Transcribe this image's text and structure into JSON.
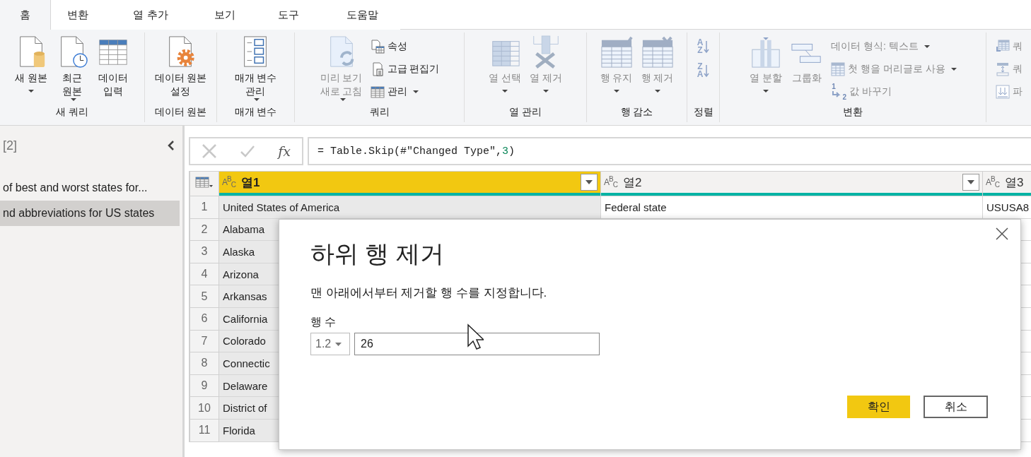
{
  "tabs": [
    {
      "label": "홈",
      "selected": true
    },
    {
      "label": "변환",
      "selected": false
    },
    {
      "label": "열 추가",
      "selected": false
    },
    {
      "label": "보기",
      "selected": false
    },
    {
      "label": "도구",
      "selected": false
    },
    {
      "label": "도움말",
      "selected": false
    }
  ],
  "ribbon": {
    "groups": [
      {
        "label": "새 쿼리",
        "items": [
          {
            "kind": "large",
            "label": "새 원본",
            "dropdown": true,
            "disabled": false
          },
          {
            "kind": "large",
            "label": "최근\n원본",
            "dropdown": true,
            "disabled": false
          },
          {
            "kind": "large",
            "label": "데이터\n입력",
            "disabled": false
          }
        ]
      },
      {
        "label": "데이터 원본",
        "items": [
          {
            "kind": "large",
            "label": "데이터 원본\n설정",
            "disabled": false
          }
        ]
      },
      {
        "label": "매개 변수",
        "items": [
          {
            "kind": "large",
            "label": "매개 변수\n관리",
            "dropdown": true,
            "disabled": false
          }
        ]
      },
      {
        "label": "쿼리",
        "items": [
          {
            "kind": "large",
            "label": "미리 보기\n새로 고침",
            "dropdown": true,
            "disabled": true
          },
          {
            "kind": "stack",
            "items": [
              {
                "label": "속성",
                "disabled": false
              },
              {
                "label": "고급 편집기",
                "disabled": false
              },
              {
                "label": "관리",
                "dropdown": true,
                "disabled": false
              }
            ]
          }
        ]
      },
      {
        "label": "열 관리",
        "items": [
          {
            "kind": "large",
            "label": "열 선택",
            "dropdown": true,
            "disabled": true
          },
          {
            "kind": "large",
            "label": "열 제거",
            "dropdown": true,
            "disabled": true
          }
        ]
      },
      {
        "label": "행 감소",
        "items": [
          {
            "kind": "large",
            "label": "행 유지",
            "dropdown": true,
            "disabled": true
          },
          {
            "kind": "large",
            "label": "행 제거",
            "dropdown": true,
            "disabled": true
          }
        ]
      },
      {
        "label": "정렬",
        "items": [
          {
            "kind": "sort",
            "top": "A",
            "bottom": "Z",
            "disabled": true
          },
          {
            "kind": "sort",
            "top": "Z",
            "bottom": "A",
            "disabled": true
          }
        ]
      },
      {
        "label": "변환",
        "items": [
          {
            "kind": "large",
            "label": "열 분할",
            "dropdown": true,
            "disabled": true
          },
          {
            "kind": "large",
            "label": "그룹화",
            "disabled": true
          },
          {
            "kind": "stack",
            "items": [
              {
                "label": "데이터 형식: 텍스트",
                "dropdown": true,
                "disabled": true
              },
              {
                "label": "첫 행을 머리글로 사용",
                "dropdown": true,
                "disabled": true
              },
              {
                "label": "값 바꾸기",
                "icon_digits": [
                  "1",
                  "2"
                ],
                "disabled": true
              }
            ]
          }
        ]
      },
      {
        "items": [
          {
            "kind": "stack",
            "items": [
              {
                "label": "쿼",
                "disabled": true
              },
              {
                "label": "쿼",
                "disabled": true
              },
              {
                "label": "파",
                "disabled": true
              }
            ]
          }
        ]
      }
    ]
  },
  "queries_pane": {
    "count": "[2]",
    "items": [
      {
        "label": "of best and worst states for...",
        "selected": false
      },
      {
        "label": "nd abbreviations for US states",
        "selected": true
      }
    ]
  },
  "formula_bar": {
    "fx": "fx",
    "text_before": "= Table.Skip(#\"Changed Type\",",
    "number": "3",
    "text_after": ")"
  },
  "table": {
    "columns": [
      {
        "type_label": "A$^{B}$$_{C}$",
        "name": "열1",
        "selected": true,
        "filter": true,
        "level": 1
      },
      {
        "type_label": "A$^{B}$$_{C}$",
        "name": "열2",
        "selected": false,
        "filter": true,
        "level": 1
      },
      {
        "type_label": "A$^{B}$$_{C}$",
        "name": "열3",
        "selected": false,
        "filter": false,
        "level": 1
      }
    ],
    "rows": [
      {
        "number": "1",
        "cells": [
          "United States of America",
          "Federal state",
          "USUSA8"
        ]
      },
      {
        "number": "2",
        "cells": [
          "Alabama"
        ]
      },
      {
        "number": "3",
        "cells": [
          "Alaska"
        ]
      },
      {
        "number": "4",
        "cells": [
          "Arizona"
        ]
      },
      {
        "number": "5",
        "cells": [
          "Arkansas"
        ]
      },
      {
        "number": "6",
        "cells": [
          "California"
        ]
      },
      {
        "number": "7",
        "cells": [
          "Colorado"
        ]
      },
      {
        "number": "8",
        "cells": [
          "Connectic"
        ]
      },
      {
        "number": "9",
        "cells": [
          "Delaware"
        ]
      },
      {
        "number": "10",
        "cells": [
          "District of"
        ]
      },
      {
        "number": "11",
        "cells": [
          "Florida"
        ]
      }
    ]
  },
  "dialog": {
    "title": "하위 행 제거",
    "description": "맨 아래에서부터 제거할 행 수를 지정합니다.",
    "field_label": "행 수",
    "type_dropdown": "1.2",
    "value": "26",
    "buttons": [
      {
        "label": "확인",
        "kind": "primary"
      },
      {
        "label": "취소",
        "kind": "secondary"
      }
    ]
  }
}
